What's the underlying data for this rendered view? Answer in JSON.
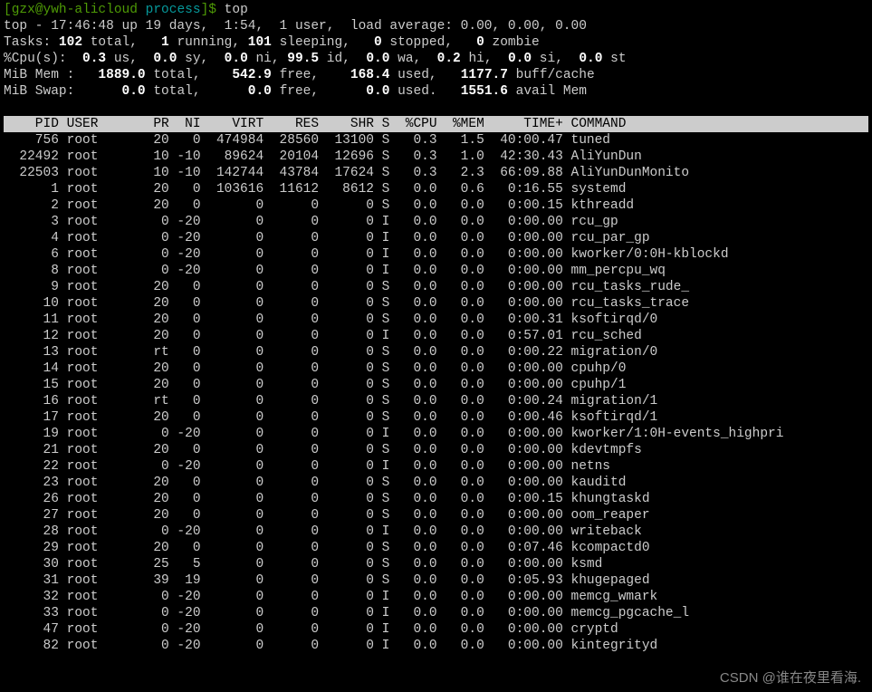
{
  "prompt": {
    "user": "gzx",
    "host": "ywh-alicloud",
    "path": "process",
    "cmd": "top"
  },
  "summary": {
    "line1": "top - 17:46:48 up 19 days,  1:54,  1 user,  load average: 0.00, 0.00, 0.00",
    "tasks": {
      "total": "102",
      "running": "1",
      "sleeping": "101",
      "stopped": "0",
      "zombie": "0"
    },
    "cpu": {
      "us": "0.3",
      "sy": "0.0",
      "ni": "0.0",
      "id": "99.5",
      "wa": "0.0",
      "hi": "0.2",
      "si": "0.0",
      "st": "0.0"
    },
    "mem": {
      "total": "1889.0",
      "free": "542.9",
      "used": "168.4",
      "buff": "1177.7"
    },
    "swap": {
      "total": "0.0",
      "free": "0.0",
      "used": "0.0",
      "avail": "1551.6"
    }
  },
  "columns": [
    "PID",
    "USER",
    "PR",
    "NI",
    "VIRT",
    "RES",
    "SHR",
    "S",
    "%CPU",
    "%MEM",
    "TIME+",
    "COMMAND"
  ],
  "rows": [
    {
      "pid": "756",
      "user": "root",
      "pr": "20",
      "ni": "0",
      "virt": "474984",
      "res": "28560",
      "shr": "13100",
      "s": "S",
      "cpu": "0.3",
      "mem": "1.5",
      "time": "40:00.47",
      "cmd": "tuned"
    },
    {
      "pid": "22492",
      "user": "root",
      "pr": "10",
      "ni": "-10",
      "virt": "89624",
      "res": "20104",
      "shr": "12696",
      "s": "S",
      "cpu": "0.3",
      "mem": "1.0",
      "time": "42:30.43",
      "cmd": "AliYunDun"
    },
    {
      "pid": "22503",
      "user": "root",
      "pr": "10",
      "ni": "-10",
      "virt": "142744",
      "res": "43784",
      "shr": "17624",
      "s": "S",
      "cpu": "0.3",
      "mem": "2.3",
      "time": "66:09.88",
      "cmd": "AliYunDunMonito"
    },
    {
      "pid": "1",
      "user": "root",
      "pr": "20",
      "ni": "0",
      "virt": "103616",
      "res": "11612",
      "shr": "8612",
      "s": "S",
      "cpu": "0.0",
      "mem": "0.6",
      "time": "0:16.55",
      "cmd": "systemd"
    },
    {
      "pid": "2",
      "user": "root",
      "pr": "20",
      "ni": "0",
      "virt": "0",
      "res": "0",
      "shr": "0",
      "s": "S",
      "cpu": "0.0",
      "mem": "0.0",
      "time": "0:00.15",
      "cmd": "kthreadd"
    },
    {
      "pid": "3",
      "user": "root",
      "pr": "0",
      "ni": "-20",
      "virt": "0",
      "res": "0",
      "shr": "0",
      "s": "I",
      "cpu": "0.0",
      "mem": "0.0",
      "time": "0:00.00",
      "cmd": "rcu_gp"
    },
    {
      "pid": "4",
      "user": "root",
      "pr": "0",
      "ni": "-20",
      "virt": "0",
      "res": "0",
      "shr": "0",
      "s": "I",
      "cpu": "0.0",
      "mem": "0.0",
      "time": "0:00.00",
      "cmd": "rcu_par_gp"
    },
    {
      "pid": "6",
      "user": "root",
      "pr": "0",
      "ni": "-20",
      "virt": "0",
      "res": "0",
      "shr": "0",
      "s": "I",
      "cpu": "0.0",
      "mem": "0.0",
      "time": "0:00.00",
      "cmd": "kworker/0:0H-kblockd"
    },
    {
      "pid": "8",
      "user": "root",
      "pr": "0",
      "ni": "-20",
      "virt": "0",
      "res": "0",
      "shr": "0",
      "s": "I",
      "cpu": "0.0",
      "mem": "0.0",
      "time": "0:00.00",
      "cmd": "mm_percpu_wq"
    },
    {
      "pid": "9",
      "user": "root",
      "pr": "20",
      "ni": "0",
      "virt": "0",
      "res": "0",
      "shr": "0",
      "s": "S",
      "cpu": "0.0",
      "mem": "0.0",
      "time": "0:00.00",
      "cmd": "rcu_tasks_rude_"
    },
    {
      "pid": "10",
      "user": "root",
      "pr": "20",
      "ni": "0",
      "virt": "0",
      "res": "0",
      "shr": "0",
      "s": "S",
      "cpu": "0.0",
      "mem": "0.0",
      "time": "0:00.00",
      "cmd": "rcu_tasks_trace"
    },
    {
      "pid": "11",
      "user": "root",
      "pr": "20",
      "ni": "0",
      "virt": "0",
      "res": "0",
      "shr": "0",
      "s": "S",
      "cpu": "0.0",
      "mem": "0.0",
      "time": "0:00.31",
      "cmd": "ksoftirqd/0"
    },
    {
      "pid": "12",
      "user": "root",
      "pr": "20",
      "ni": "0",
      "virt": "0",
      "res": "0",
      "shr": "0",
      "s": "I",
      "cpu": "0.0",
      "mem": "0.0",
      "time": "0:57.01",
      "cmd": "rcu_sched"
    },
    {
      "pid": "13",
      "user": "root",
      "pr": "rt",
      "ni": "0",
      "virt": "0",
      "res": "0",
      "shr": "0",
      "s": "S",
      "cpu": "0.0",
      "mem": "0.0",
      "time": "0:00.22",
      "cmd": "migration/0"
    },
    {
      "pid": "14",
      "user": "root",
      "pr": "20",
      "ni": "0",
      "virt": "0",
      "res": "0",
      "shr": "0",
      "s": "S",
      "cpu": "0.0",
      "mem": "0.0",
      "time": "0:00.00",
      "cmd": "cpuhp/0"
    },
    {
      "pid": "15",
      "user": "root",
      "pr": "20",
      "ni": "0",
      "virt": "0",
      "res": "0",
      "shr": "0",
      "s": "S",
      "cpu": "0.0",
      "mem": "0.0",
      "time": "0:00.00",
      "cmd": "cpuhp/1"
    },
    {
      "pid": "16",
      "user": "root",
      "pr": "rt",
      "ni": "0",
      "virt": "0",
      "res": "0",
      "shr": "0",
      "s": "S",
      "cpu": "0.0",
      "mem": "0.0",
      "time": "0:00.24",
      "cmd": "migration/1"
    },
    {
      "pid": "17",
      "user": "root",
      "pr": "20",
      "ni": "0",
      "virt": "0",
      "res": "0",
      "shr": "0",
      "s": "S",
      "cpu": "0.0",
      "mem": "0.0",
      "time": "0:00.46",
      "cmd": "ksoftirqd/1"
    },
    {
      "pid": "19",
      "user": "root",
      "pr": "0",
      "ni": "-20",
      "virt": "0",
      "res": "0",
      "shr": "0",
      "s": "I",
      "cpu": "0.0",
      "mem": "0.0",
      "time": "0:00.00",
      "cmd": "kworker/1:0H-events_highpri"
    },
    {
      "pid": "21",
      "user": "root",
      "pr": "20",
      "ni": "0",
      "virt": "0",
      "res": "0",
      "shr": "0",
      "s": "S",
      "cpu": "0.0",
      "mem": "0.0",
      "time": "0:00.00",
      "cmd": "kdevtmpfs"
    },
    {
      "pid": "22",
      "user": "root",
      "pr": "0",
      "ni": "-20",
      "virt": "0",
      "res": "0",
      "shr": "0",
      "s": "I",
      "cpu": "0.0",
      "mem": "0.0",
      "time": "0:00.00",
      "cmd": "netns"
    },
    {
      "pid": "23",
      "user": "root",
      "pr": "20",
      "ni": "0",
      "virt": "0",
      "res": "0",
      "shr": "0",
      "s": "S",
      "cpu": "0.0",
      "mem": "0.0",
      "time": "0:00.00",
      "cmd": "kauditd"
    },
    {
      "pid": "26",
      "user": "root",
      "pr": "20",
      "ni": "0",
      "virt": "0",
      "res": "0",
      "shr": "0",
      "s": "S",
      "cpu": "0.0",
      "mem": "0.0",
      "time": "0:00.15",
      "cmd": "khungtaskd"
    },
    {
      "pid": "27",
      "user": "root",
      "pr": "20",
      "ni": "0",
      "virt": "0",
      "res": "0",
      "shr": "0",
      "s": "S",
      "cpu": "0.0",
      "mem": "0.0",
      "time": "0:00.00",
      "cmd": "oom_reaper"
    },
    {
      "pid": "28",
      "user": "root",
      "pr": "0",
      "ni": "-20",
      "virt": "0",
      "res": "0",
      "shr": "0",
      "s": "I",
      "cpu": "0.0",
      "mem": "0.0",
      "time": "0:00.00",
      "cmd": "writeback"
    },
    {
      "pid": "29",
      "user": "root",
      "pr": "20",
      "ni": "0",
      "virt": "0",
      "res": "0",
      "shr": "0",
      "s": "S",
      "cpu": "0.0",
      "mem": "0.0",
      "time": "0:07.46",
      "cmd": "kcompactd0"
    },
    {
      "pid": "30",
      "user": "root",
      "pr": "25",
      "ni": "5",
      "virt": "0",
      "res": "0",
      "shr": "0",
      "s": "S",
      "cpu": "0.0",
      "mem": "0.0",
      "time": "0:00.00",
      "cmd": "ksmd"
    },
    {
      "pid": "31",
      "user": "root",
      "pr": "39",
      "ni": "19",
      "virt": "0",
      "res": "0",
      "shr": "0",
      "s": "S",
      "cpu": "0.0",
      "mem": "0.0",
      "time": "0:05.93",
      "cmd": "khugepaged"
    },
    {
      "pid": "32",
      "user": "root",
      "pr": "0",
      "ni": "-20",
      "virt": "0",
      "res": "0",
      "shr": "0",
      "s": "I",
      "cpu": "0.0",
      "mem": "0.0",
      "time": "0:00.00",
      "cmd": "memcg_wmark"
    },
    {
      "pid": "33",
      "user": "root",
      "pr": "0",
      "ni": "-20",
      "virt": "0",
      "res": "0",
      "shr": "0",
      "s": "I",
      "cpu": "0.0",
      "mem": "0.0",
      "time": "0:00.00",
      "cmd": "memcg_pgcache_l"
    },
    {
      "pid": "47",
      "user": "root",
      "pr": "0",
      "ni": "-20",
      "virt": "0",
      "res": "0",
      "shr": "0",
      "s": "I",
      "cpu": "0.0",
      "mem": "0.0",
      "time": "0:00.00",
      "cmd": "cryptd"
    },
    {
      "pid": "82",
      "user": "root",
      "pr": "0",
      "ni": "-20",
      "virt": "0",
      "res": "0",
      "shr": "0",
      "s": "I",
      "cpu": "0.0",
      "mem": "0.0",
      "time": "0:00.00",
      "cmd": "kintegrityd"
    }
  ],
  "watermark": "CSDN @谁在夜里看海."
}
